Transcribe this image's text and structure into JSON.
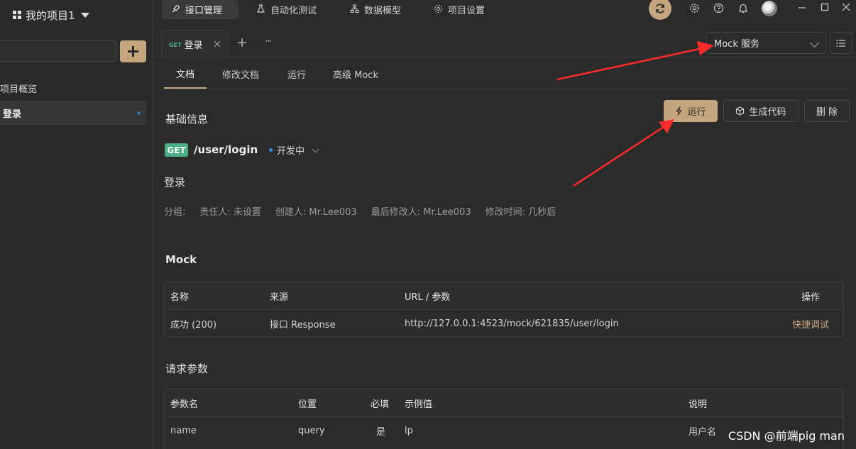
{
  "sidebar": {
    "project_name": "我的项目1",
    "search_value": "",
    "items": [
      {
        "label": "项目概览"
      },
      {
        "label": "登录"
      }
    ]
  },
  "topbar": {
    "tabs": [
      {
        "label": "接口管理",
        "icon": "rocket-icon"
      },
      {
        "label": "自动化测试",
        "icon": "flask-icon"
      },
      {
        "label": "数据模型",
        "icon": "model-icon"
      },
      {
        "label": "项目设置",
        "icon": "gear-icon"
      }
    ]
  },
  "doc_tabs": {
    "tab": {
      "method": "GET",
      "label": "登录"
    },
    "more_glyph": "···"
  },
  "environment": {
    "selected": "Mock 服务"
  },
  "sub_tabs": [
    {
      "label": "文档"
    },
    {
      "label": "修改文档"
    },
    {
      "label": "运行"
    },
    {
      "label": "高级 Mock"
    }
  ],
  "basic_info": {
    "heading": "基础信息",
    "method": "GET",
    "path": "/user/login",
    "status": "开发中",
    "api_name": "登录",
    "meta": {
      "group": "分组:",
      "owner": "责任人: 未设置",
      "creator": "创建人:  Mr.Lee003",
      "last_modifier": "最后修改人:  Mr.Lee003",
      "modified_time": "修改时间: 几秒后"
    }
  },
  "actions": {
    "run": "运行",
    "generate_code": "生成代码",
    "delete": "删 除"
  },
  "mock": {
    "heading": "Mock",
    "columns": [
      "名称",
      "来源",
      "URL / 参数",
      "操作"
    ],
    "rows": [
      {
        "name": "成功 (200)",
        "source": "接口 Response",
        "url": "http://127.0.0.1:4523/mock/621835/user/login",
        "action": "快捷调试"
      }
    ]
  },
  "request_params": {
    "heading": "请求参数",
    "columns": [
      "参数名",
      "位置",
      "必填",
      "示例值",
      "说明"
    ],
    "rows": [
      {
        "name": "name",
        "location": "query",
        "required": "是",
        "example": "lp",
        "description": "用户名"
      }
    ]
  },
  "watermark": "CSDN @前端pig man",
  "colors": {
    "accent": "#c5a57d",
    "get_method": "#4cae86",
    "status_dot": "#3f8fe0",
    "annotation_arrow": "#ff2a2a"
  }
}
